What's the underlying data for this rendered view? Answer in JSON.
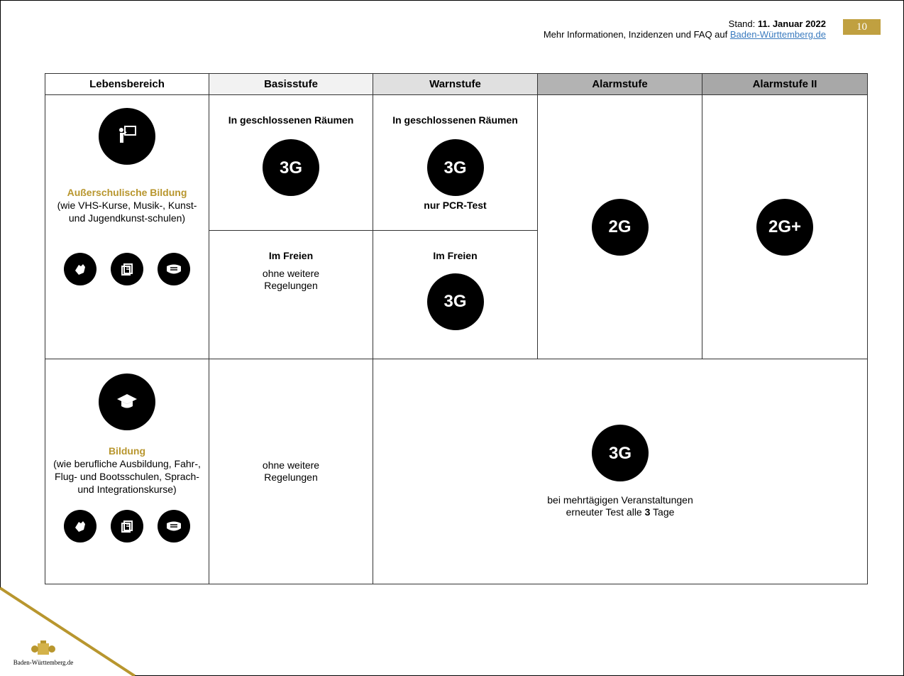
{
  "header": {
    "stand_prefix": "Stand: ",
    "stand_date": "11. Januar 2022",
    "info_text": "Mehr Informationen, Inzidenzen und FAQ auf ",
    "info_link": "Baden-Württemberg.de",
    "page_number": "10"
  },
  "columns": [
    "Lebensbereich",
    "Basisstufe",
    "Warnstufe",
    "Alarmstufe",
    "Alarmstufe II"
  ],
  "row1": {
    "title": "Außerschulische Bildung",
    "desc": "(wie VHS-Kurse, Musik-, Kunst- und Jugendkunst-schulen)",
    "basis_indoor_title": "In geschlossenen Räumen",
    "basis_indoor_badge": "3G",
    "warn_indoor_title": "In geschlossenen Räumen",
    "warn_indoor_badge": "3G",
    "warn_indoor_note": "nur PCR-Test",
    "basis_outdoor_title": "Im Freien",
    "basis_outdoor_note": "ohne weitere Regelungen",
    "warn_outdoor_title": "Im Freien",
    "warn_outdoor_badge": "3G",
    "alarm_badge": "2G",
    "alarm2_badge": "2G+"
  },
  "row2": {
    "title": "Bildung",
    "desc": "(wie berufliche Ausbildung, Fahr-, Flug- und Bootsschulen, Sprach- und Integrationskurse)",
    "basis_note": "ohne weitere Regelungen",
    "rest_badge": "3G",
    "rest_note_line1": "bei mehrtägigen Veranstaltungen",
    "rest_note_prefix": "erneuter Test alle ",
    "rest_note_num": "3",
    "rest_note_suffix": " Tage"
  },
  "footer": {
    "logo_text": "Baden-Württemberg.de"
  },
  "colors": {
    "accent_gold": "#b8962e",
    "page_badge": "#c0a040",
    "link": "#3b7bbf"
  }
}
